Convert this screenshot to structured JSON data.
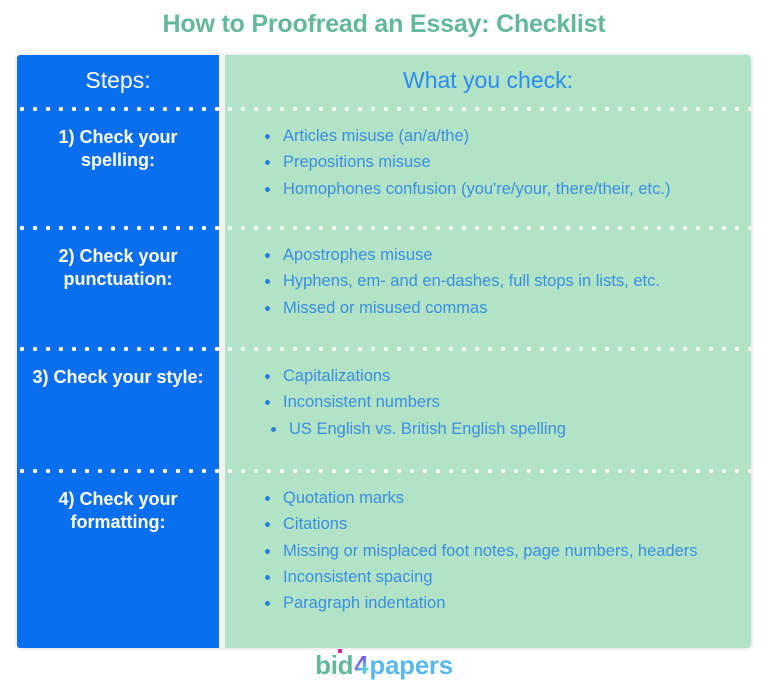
{
  "title": "How to Proofread an Essay: Checklist",
  "table": {
    "headers": {
      "steps": "Steps:",
      "checks": "What you check:"
    },
    "rows": [
      {
        "step": "1) Check your spelling:",
        "checks": [
          "Articles misuse (an/a/the)",
          "Prepositions misuse",
          "Homophones confusion (you're/your, there/their, etc.)"
        ]
      },
      {
        "step": "2) Check your punctuation:",
        "checks": [
          "Apostrophes misuse",
          "Hyphens, em- and en-dashes, full stops in lists, etc.",
          "Missed or misused commas"
        ]
      },
      {
        "step": "3) Check your style:",
        "checks": [
          "Capitalizations",
          "Inconsistent numbers",
          "US English vs. British English spelling"
        ]
      },
      {
        "step": "4) Check your formatting:",
        "checks": [
          "Quotation marks",
          "Citations",
          "Missing or misplaced foot notes, page numbers, headers",
          "Inconsistent spacing",
          "Paragraph indentation"
        ]
      }
    ]
  },
  "logo": {
    "prefix": "bid",
    "numeral": "4",
    "suffix": "papers"
  },
  "colors": {
    "title": "#63b89b",
    "steps_column": "#0a6ef0",
    "checks_column": "#b2e3c6",
    "checks_text": "#3b8fe0",
    "checks_header_text": "#2d8cf0",
    "logo_prefix": "#63b89b",
    "logo_suffix": "#5bb8e8",
    "logo_dot": "#e0219b"
  }
}
